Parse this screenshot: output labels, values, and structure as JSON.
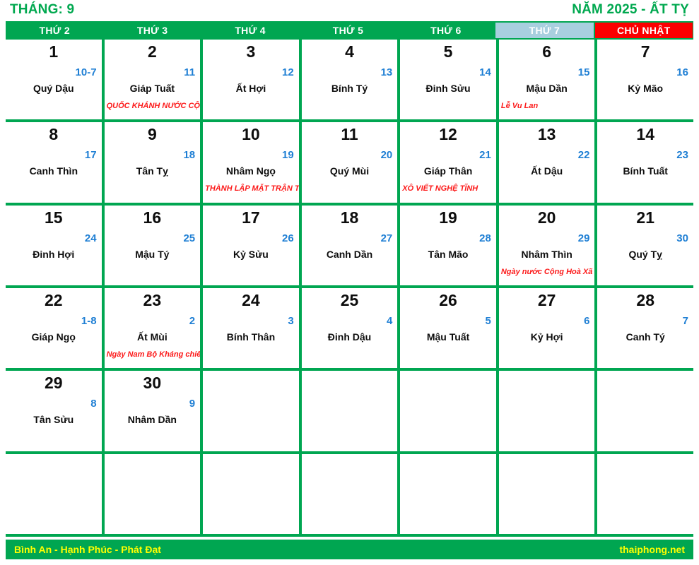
{
  "header": {
    "month_label": "THÁNG: 9",
    "year_label": "NĂM 2025 - ẤT TỴ",
    "accent_green": "#00a651",
    "saturday_bg": "#a8cfdf",
    "sunday_bg": "#fc0000",
    "lunar_color": "#1f7fd4",
    "event_color": "#fc1a1a",
    "footer_text_color": "#ffff00"
  },
  "weekdays": [
    {
      "label": "THỨ 2",
      "style": "normal"
    },
    {
      "label": "THỨ 3",
      "style": "normal"
    },
    {
      "label": "THỨ 4",
      "style": "normal"
    },
    {
      "label": "THỨ 5",
      "style": "normal"
    },
    {
      "label": "THỨ 6",
      "style": "normal"
    },
    {
      "label": "THỨ 7",
      "style": "sat"
    },
    {
      "label": "CHỦ NHẬT",
      "style": "sun"
    }
  ],
  "cells": [
    {
      "solar": "1",
      "lunar": "10-7",
      "canchi": "Quý Dậu",
      "event": ""
    },
    {
      "solar": "2",
      "lunar": "11",
      "canchi": "Giáp Tuất",
      "event": "QUỐC KHÁNH NƯỚC CỘNG HOÀ XÃ HỘI CHỦ NGHĨA VIỆT NAM"
    },
    {
      "solar": "3",
      "lunar": "12",
      "canchi": "Ất Hợi",
      "event": ""
    },
    {
      "solar": "4",
      "lunar": "13",
      "canchi": "Bính Tý",
      "event": ""
    },
    {
      "solar": "5",
      "lunar": "14",
      "canchi": "Đinh Sửu",
      "event": ""
    },
    {
      "solar": "6",
      "lunar": "15",
      "canchi": "Mậu Dần",
      "event": "Lễ Vu Lan"
    },
    {
      "solar": "7",
      "lunar": "16",
      "canchi": "Kỷ Mão",
      "event": ""
    },
    {
      "solar": "8",
      "lunar": "17",
      "canchi": "Canh Thìn",
      "event": ""
    },
    {
      "solar": "9",
      "lunar": "18",
      "canchi": "Tân Tỵ",
      "event": ""
    },
    {
      "solar": "10",
      "lunar": "19",
      "canchi": "Nhâm Ngọ",
      "event": "THÀNH LẬP MẶT TRẬN TỔ QUỐC VIỆT NAM"
    },
    {
      "solar": "11",
      "lunar": "20",
      "canchi": "Quý Mùi",
      "event": ""
    },
    {
      "solar": "12",
      "lunar": "21",
      "canchi": "Giáp Thân",
      "event": "XÔ VIẾT NGHỆ TĨNH"
    },
    {
      "solar": "13",
      "lunar": "22",
      "canchi": "Ất Dậu",
      "event": ""
    },
    {
      "solar": "14",
      "lunar": "23",
      "canchi": "Bính Tuất",
      "event": ""
    },
    {
      "solar": "15",
      "lunar": "24",
      "canchi": "Đinh Hợi",
      "event": ""
    },
    {
      "solar": "16",
      "lunar": "25",
      "canchi": "Mậu Tý",
      "event": ""
    },
    {
      "solar": "17",
      "lunar": "26",
      "canchi": "Kỷ Sửu",
      "event": ""
    },
    {
      "solar": "18",
      "lunar": "27",
      "canchi": "Canh Dần",
      "event": ""
    },
    {
      "solar": "19",
      "lunar": "28",
      "canchi": "Tân Mão",
      "event": ""
    },
    {
      "solar": "20",
      "lunar": "29",
      "canchi": "Nhâm Thìn",
      "event": "Ngày nước Cộng Hoà Xã Hội Chủ Nghĩa Việt Nam"
    },
    {
      "solar": "21",
      "lunar": "30",
      "canchi": "Quý Tỵ",
      "event": ""
    },
    {
      "solar": "22",
      "lunar": "1-8",
      "canchi": "Giáp Ngọ",
      "event": ""
    },
    {
      "solar": "23",
      "lunar": "2",
      "canchi": "Ất Mùi",
      "event": "Ngày Nam Bộ Kháng chiến"
    },
    {
      "solar": "24",
      "lunar": "3",
      "canchi": "Bính Thân",
      "event": ""
    },
    {
      "solar": "25",
      "lunar": "4",
      "canchi": "Đinh Dậu",
      "event": ""
    },
    {
      "solar": "26",
      "lunar": "5",
      "canchi": "Mậu Tuất",
      "event": ""
    },
    {
      "solar": "27",
      "lunar": "6",
      "canchi": "Kỷ Hợi",
      "event": ""
    },
    {
      "solar": "28",
      "lunar": "7",
      "canchi": "Canh Tý",
      "event": ""
    },
    {
      "solar": "29",
      "lunar": "8",
      "canchi": "Tân Sửu",
      "event": ""
    },
    {
      "solar": "30",
      "lunar": "9",
      "canchi": "Nhâm Dần",
      "event": ""
    },
    {
      "solar": "",
      "lunar": "",
      "canchi": "",
      "event": ""
    },
    {
      "solar": "",
      "lunar": "",
      "canchi": "",
      "event": ""
    },
    {
      "solar": "",
      "lunar": "",
      "canchi": "",
      "event": ""
    },
    {
      "solar": "",
      "lunar": "",
      "canchi": "",
      "event": ""
    },
    {
      "solar": "",
      "lunar": "",
      "canchi": "",
      "event": ""
    },
    {
      "solar": "",
      "lunar": "",
      "canchi": "",
      "event": ""
    },
    {
      "solar": "",
      "lunar": "",
      "canchi": "",
      "event": ""
    },
    {
      "solar": "",
      "lunar": "",
      "canchi": "",
      "event": ""
    },
    {
      "solar": "",
      "lunar": "",
      "canchi": "",
      "event": ""
    },
    {
      "solar": "",
      "lunar": "",
      "canchi": "",
      "event": ""
    },
    {
      "solar": "",
      "lunar": "",
      "canchi": "",
      "event": ""
    },
    {
      "solar": "",
      "lunar": "",
      "canchi": "",
      "event": ""
    }
  ],
  "footer": {
    "slogan": "Bình An - Hạnh Phúc - Phát Đạt",
    "site": "thaiphong.net"
  }
}
